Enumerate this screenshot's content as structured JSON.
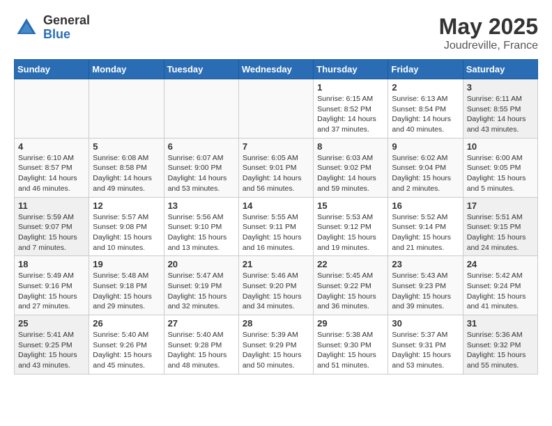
{
  "header": {
    "logo_general": "General",
    "logo_blue": "Blue",
    "title": "May 2025",
    "location": "Joudreville, France"
  },
  "weekdays": [
    "Sunday",
    "Monday",
    "Tuesday",
    "Wednesday",
    "Thursday",
    "Friday",
    "Saturday"
  ],
  "weeks": [
    [
      {
        "day": "",
        "info": ""
      },
      {
        "day": "",
        "info": ""
      },
      {
        "day": "",
        "info": ""
      },
      {
        "day": "",
        "info": ""
      },
      {
        "day": "1",
        "info": "Sunrise: 6:15 AM\nSunset: 8:52 PM\nDaylight: 14 hours\nand 37 minutes."
      },
      {
        "day": "2",
        "info": "Sunrise: 6:13 AM\nSunset: 8:54 PM\nDaylight: 14 hours\nand 40 minutes."
      },
      {
        "day": "3",
        "info": "Sunrise: 6:11 AM\nSunset: 8:55 PM\nDaylight: 14 hours\nand 43 minutes."
      }
    ],
    [
      {
        "day": "4",
        "info": "Sunrise: 6:10 AM\nSunset: 8:57 PM\nDaylight: 14 hours\nand 46 minutes."
      },
      {
        "day": "5",
        "info": "Sunrise: 6:08 AM\nSunset: 8:58 PM\nDaylight: 14 hours\nand 49 minutes."
      },
      {
        "day": "6",
        "info": "Sunrise: 6:07 AM\nSunset: 9:00 PM\nDaylight: 14 hours\nand 53 minutes."
      },
      {
        "day": "7",
        "info": "Sunrise: 6:05 AM\nSunset: 9:01 PM\nDaylight: 14 hours\nand 56 minutes."
      },
      {
        "day": "8",
        "info": "Sunrise: 6:03 AM\nSunset: 9:02 PM\nDaylight: 14 hours\nand 59 minutes."
      },
      {
        "day": "9",
        "info": "Sunrise: 6:02 AM\nSunset: 9:04 PM\nDaylight: 15 hours\nand 2 minutes."
      },
      {
        "day": "10",
        "info": "Sunrise: 6:00 AM\nSunset: 9:05 PM\nDaylight: 15 hours\nand 5 minutes."
      }
    ],
    [
      {
        "day": "11",
        "info": "Sunrise: 5:59 AM\nSunset: 9:07 PM\nDaylight: 15 hours\nand 7 minutes."
      },
      {
        "day": "12",
        "info": "Sunrise: 5:57 AM\nSunset: 9:08 PM\nDaylight: 15 hours\nand 10 minutes."
      },
      {
        "day": "13",
        "info": "Sunrise: 5:56 AM\nSunset: 9:10 PM\nDaylight: 15 hours\nand 13 minutes."
      },
      {
        "day": "14",
        "info": "Sunrise: 5:55 AM\nSunset: 9:11 PM\nDaylight: 15 hours\nand 16 minutes."
      },
      {
        "day": "15",
        "info": "Sunrise: 5:53 AM\nSunset: 9:12 PM\nDaylight: 15 hours\nand 19 minutes."
      },
      {
        "day": "16",
        "info": "Sunrise: 5:52 AM\nSunset: 9:14 PM\nDaylight: 15 hours\nand 21 minutes."
      },
      {
        "day": "17",
        "info": "Sunrise: 5:51 AM\nSunset: 9:15 PM\nDaylight: 15 hours\nand 24 minutes."
      }
    ],
    [
      {
        "day": "18",
        "info": "Sunrise: 5:49 AM\nSunset: 9:16 PM\nDaylight: 15 hours\nand 27 minutes."
      },
      {
        "day": "19",
        "info": "Sunrise: 5:48 AM\nSunset: 9:18 PM\nDaylight: 15 hours\nand 29 minutes."
      },
      {
        "day": "20",
        "info": "Sunrise: 5:47 AM\nSunset: 9:19 PM\nDaylight: 15 hours\nand 32 minutes."
      },
      {
        "day": "21",
        "info": "Sunrise: 5:46 AM\nSunset: 9:20 PM\nDaylight: 15 hours\nand 34 minutes."
      },
      {
        "day": "22",
        "info": "Sunrise: 5:45 AM\nSunset: 9:22 PM\nDaylight: 15 hours\nand 36 minutes."
      },
      {
        "day": "23",
        "info": "Sunrise: 5:43 AM\nSunset: 9:23 PM\nDaylight: 15 hours\nand 39 minutes."
      },
      {
        "day": "24",
        "info": "Sunrise: 5:42 AM\nSunset: 9:24 PM\nDaylight: 15 hours\nand 41 minutes."
      }
    ],
    [
      {
        "day": "25",
        "info": "Sunrise: 5:41 AM\nSunset: 9:25 PM\nDaylight: 15 hours\nand 43 minutes."
      },
      {
        "day": "26",
        "info": "Sunrise: 5:40 AM\nSunset: 9:26 PM\nDaylight: 15 hours\nand 45 minutes."
      },
      {
        "day": "27",
        "info": "Sunrise: 5:40 AM\nSunset: 9:28 PM\nDaylight: 15 hours\nand 48 minutes."
      },
      {
        "day": "28",
        "info": "Sunrise: 5:39 AM\nSunset: 9:29 PM\nDaylight: 15 hours\nand 50 minutes."
      },
      {
        "day": "29",
        "info": "Sunrise: 5:38 AM\nSunset: 9:30 PM\nDaylight: 15 hours\nand 51 minutes."
      },
      {
        "day": "30",
        "info": "Sunrise: 5:37 AM\nSunset: 9:31 PM\nDaylight: 15 hours\nand 53 minutes."
      },
      {
        "day": "31",
        "info": "Sunrise: 5:36 AM\nSunset: 9:32 PM\nDaylight: 15 hours\nand 55 minutes."
      }
    ]
  ]
}
